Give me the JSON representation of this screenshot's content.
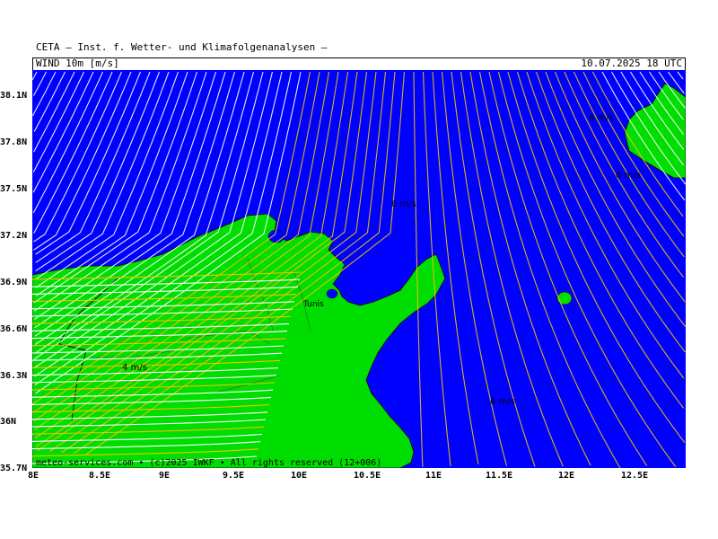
{
  "header": {
    "title": "CETA – Inst. f. Wetter- und Klimafolgenanalysen –",
    "parameter": "WIND 10m [m/s]",
    "valid_time": "10.07.2025 18 UTC"
  },
  "map": {
    "region": "Tunisia / Sicily Channel",
    "lon_range": [
      8.0,
      12.85
    ],
    "lat_range": [
      35.7,
      38.25
    ],
    "lat_ticks": [
      "38.1N",
      "37.8N",
      "37.5N",
      "37.2N",
      "36.9N",
      "36.6N",
      "36.3N",
      "36N",
      "35.7N"
    ],
    "lon_ticks": [
      "8E",
      "8.5E",
      "9E",
      "9.5E",
      "10E",
      "10.5E",
      "11E",
      "11.5E",
      "12E",
      "12.5E"
    ],
    "colors": {
      "sea": "#0000ff",
      "land": "#00dd00",
      "streamline_slow": "#ffffff",
      "streamline_fast": "#f2c200"
    },
    "speed_labels": [
      "4 m/s",
      "6 m/s",
      "6 m/s",
      "6 m/s",
      "6 m/s"
    ],
    "place_label": "Tunis",
    "footer": "meteo-services.com • (c)2025 IWKF • All rights reserved (12+006)"
  }
}
